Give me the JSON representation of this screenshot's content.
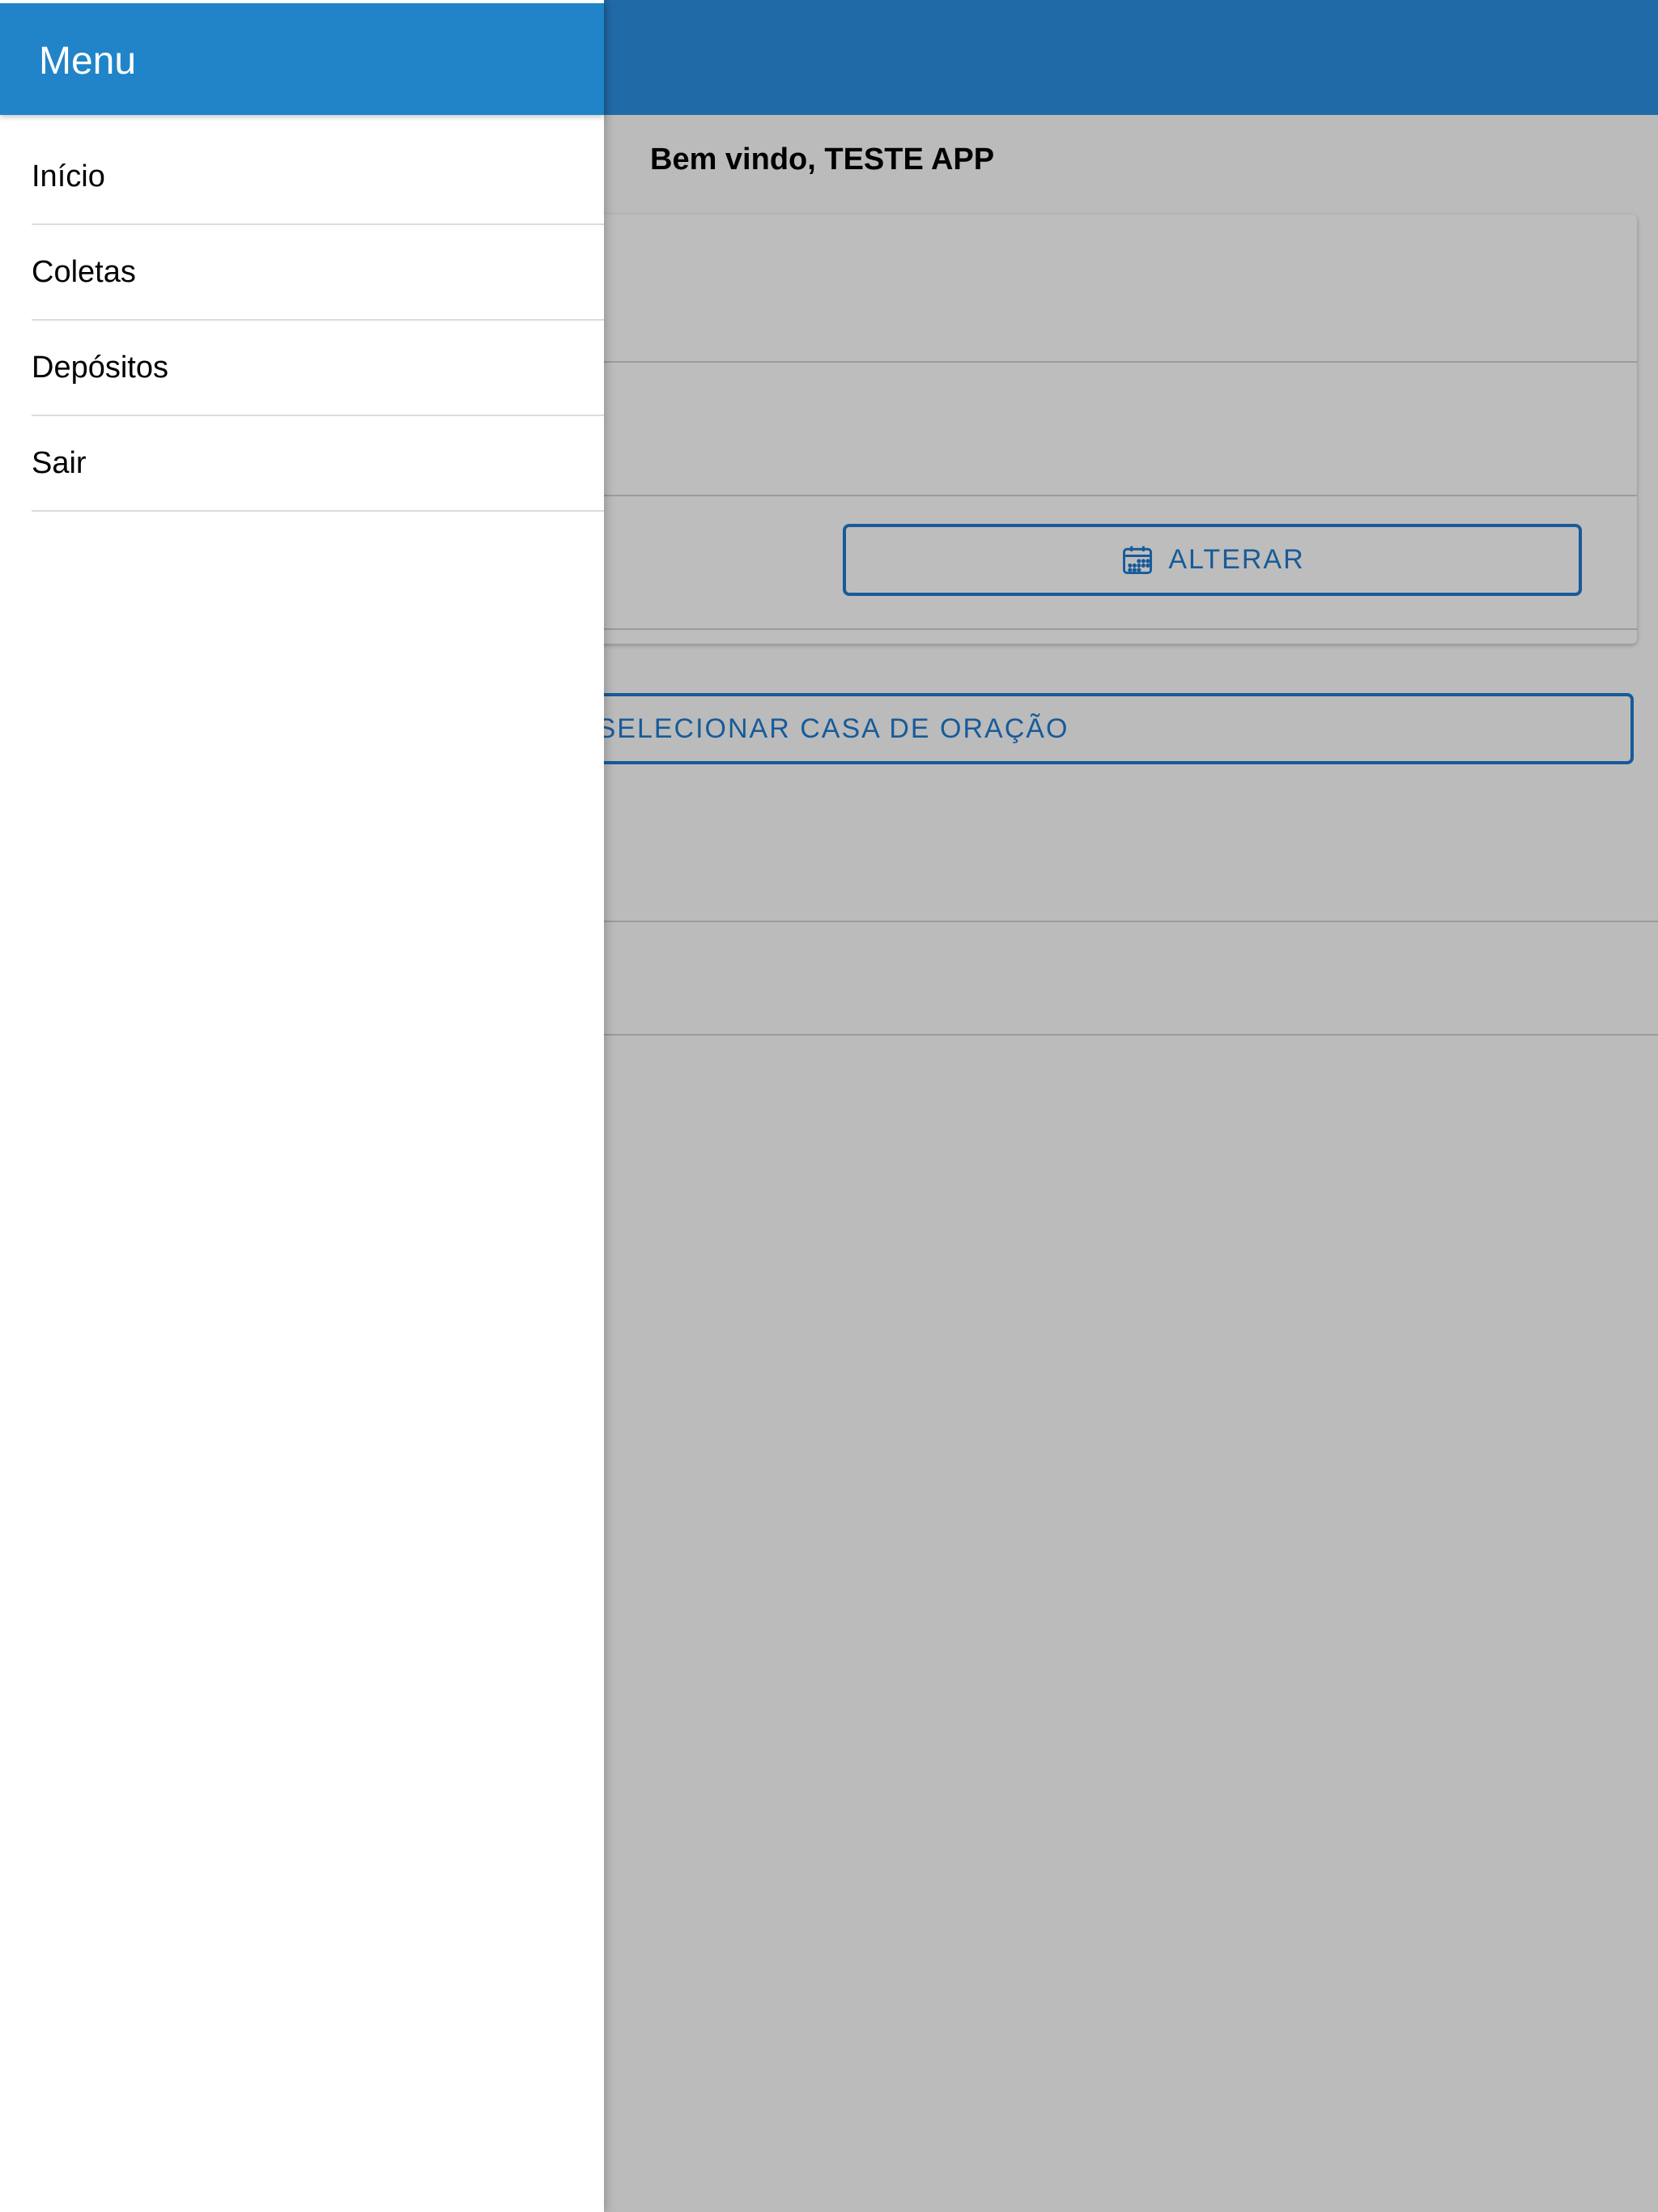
{
  "menu": {
    "title": "Menu",
    "items": [
      {
        "label": "Início"
      },
      {
        "label": "Coletas"
      },
      {
        "label": "Depósitos"
      },
      {
        "label": "Sair"
      }
    ]
  },
  "page": {
    "welcome": "Bem vindo, TESTE APP",
    "alterar_label": "ALTERAR",
    "select_house_label": "SELECIONAR CASA DE ORAÇÃO"
  },
  "icons": {
    "calendar": "calendar-icon"
  },
  "colors": {
    "toolbar": "#2d8ee0",
    "menu_header": "#2184c9",
    "accent": "#1f7acc"
  }
}
